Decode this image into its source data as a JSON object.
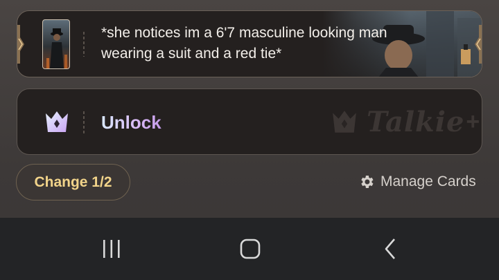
{
  "reply_card": {
    "text": "*she notices im a 6'7 masculine looking man wearing a suit and a red tie*"
  },
  "unlock_card": {
    "label": "Unlock",
    "watermark_brand": "Talkie",
    "watermark_plus": "+"
  },
  "actions": {
    "change_label": "Change 1/2",
    "manage_label": "Manage Cards"
  },
  "navbar": {
    "recent_icon": "recent-apps-icon",
    "home_icon": "home-icon",
    "back_icon": "back-icon"
  },
  "colors": {
    "background": "#423d3c",
    "card": "#24201f",
    "change_text": "#f2d48a",
    "unlock_gradient_start": "#d9e9ff",
    "unlock_gradient_end": "#c49be9",
    "navbar": "#232426"
  }
}
